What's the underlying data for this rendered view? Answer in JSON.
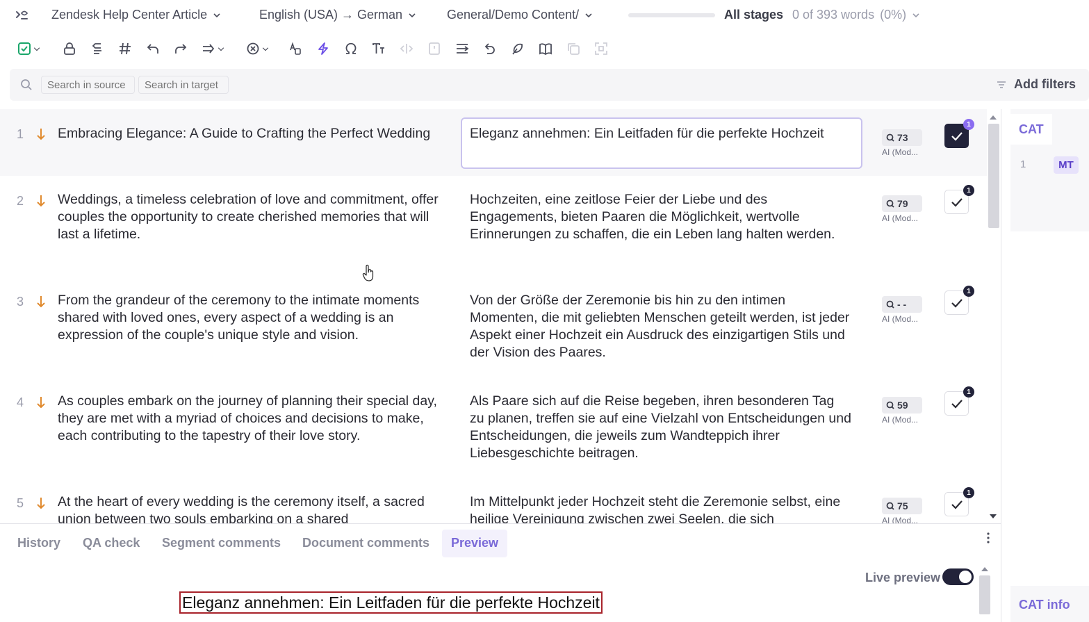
{
  "header": {
    "project": "Zendesk Help Center Article",
    "language_pair": "English (USA) → German",
    "folder": "General/Demo Content/",
    "progress": 0,
    "stage": "All stages",
    "word_count": "0 of 393 words",
    "word_percent": "(0%)"
  },
  "toolbar": {
    "icons": [
      "confirm-icon",
      "lock-icon",
      "copy-source-icon",
      "tags-icon",
      "undo-icon",
      "redo-icon",
      "join-icon",
      "clear-icon",
      "case-icon",
      "lightning-icon",
      "omega-icon",
      "text-size-icon",
      "code-icon",
      "split-icon",
      "sort-icon",
      "revert-icon",
      "stamp-icon",
      "book-icon",
      "copy-icon",
      "expand-icon"
    ]
  },
  "search": {
    "source_placeholder": "Search in source",
    "target_placeholder": "Search in target",
    "filters_label": "Add filters"
  },
  "segments": [
    {
      "num": "1",
      "source": "Embracing Elegance: A Guide to Crafting the Perfect Wedding",
      "target": "Eleganz annehmen: Ein Leitfaden für die perfekte Hochzeit",
      "score": "73",
      "origin": "AI (Mod...",
      "confirmed": true,
      "badge": "1"
    },
    {
      "num": "2",
      "source": "Weddings, a timeless celebration of love and commitment, offer couples the opportunity to create cherished memories that will last a lifetime.",
      "target": "Hochzeiten, eine zeitlose Feier der Liebe und des Engagements, bieten Paaren die Möglichkeit, wertvolle Erinnerungen zu schaffen, die ein Leben lang halten werden.",
      "score": "79",
      "origin": "AI (Mod...",
      "confirmed": false,
      "badge": "1"
    },
    {
      "num": "3",
      "source": "From the grandeur of the ceremony to the intimate moments shared with loved ones, every aspect of a wedding is an expression of the couple's unique style and vision.",
      "target": "Von der Größe der Zeremonie bis hin zu den intimen Momenten, die mit geliebten Menschen geteilt werden, ist jeder Aspekt einer Hochzeit ein Ausdruck des einzigartigen Stils und der Vision des Paares.",
      "score": "- -",
      "origin": "AI (Mod...",
      "confirmed": false,
      "badge": "1"
    },
    {
      "num": "4",
      "source": "As couples embark on the journey of planning their special day, they are met with a myriad of choices and decisions to make, each contributing to the tapestry of their love story.",
      "target": "Als Paare sich auf die Reise begeben, ihren besonderen Tag zu planen, treffen sie auf eine Vielzahl von Entscheidungen und Entscheidungen, die jeweils zum Wandteppich ihrer Liebesgeschichte beitragen.",
      "score": "59",
      "origin": "AI (Mod...",
      "confirmed": false,
      "badge": "1"
    },
    {
      "num": "5",
      "source": "At the heart of every wedding is the ceremony itself, a sacred union between two souls embarking on a shared",
      "target": "Im Mittelpunkt jeder Hochzeit steht die Zeremonie selbst, eine heilige Vereinigung zwischen zwei Seelen, die sich",
      "score": "75",
      "origin": "AI (Mod...",
      "confirmed": false,
      "badge": "1"
    }
  ],
  "cat_panel": {
    "tab": "CAT",
    "row_num": "1",
    "row_badge": "MT",
    "info_label": "CAT info"
  },
  "bottom": {
    "tabs": [
      "History",
      "QA check",
      "Segment comments",
      "Document comments",
      "Preview"
    ],
    "active_tab": "Preview",
    "live_preview_label": "Live preview",
    "live_preview_on": true,
    "preview_text": "Eleganz annehmen: Ein Leitfaden für die perfekte Hochzeit"
  },
  "colors": {
    "accent": "#7a6ad8",
    "segment_arrow": "#e08a2e",
    "confirmed": "#22233a",
    "preview_outline": "#a8232b"
  }
}
